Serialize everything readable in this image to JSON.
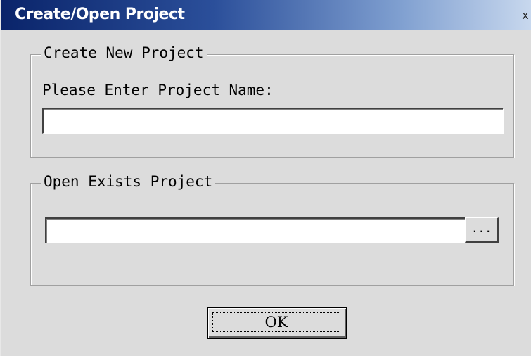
{
  "window": {
    "title": "Create/Open Project",
    "close_glyph": "x"
  },
  "create_group": {
    "legend": "Create New Project",
    "prompt_label": "Please Enter Project Name:",
    "project_name_value": ""
  },
  "open_group": {
    "legend": "Open Exists Project",
    "path_value": "",
    "browse_label": "..."
  },
  "ok_button": {
    "label": "OK"
  }
}
